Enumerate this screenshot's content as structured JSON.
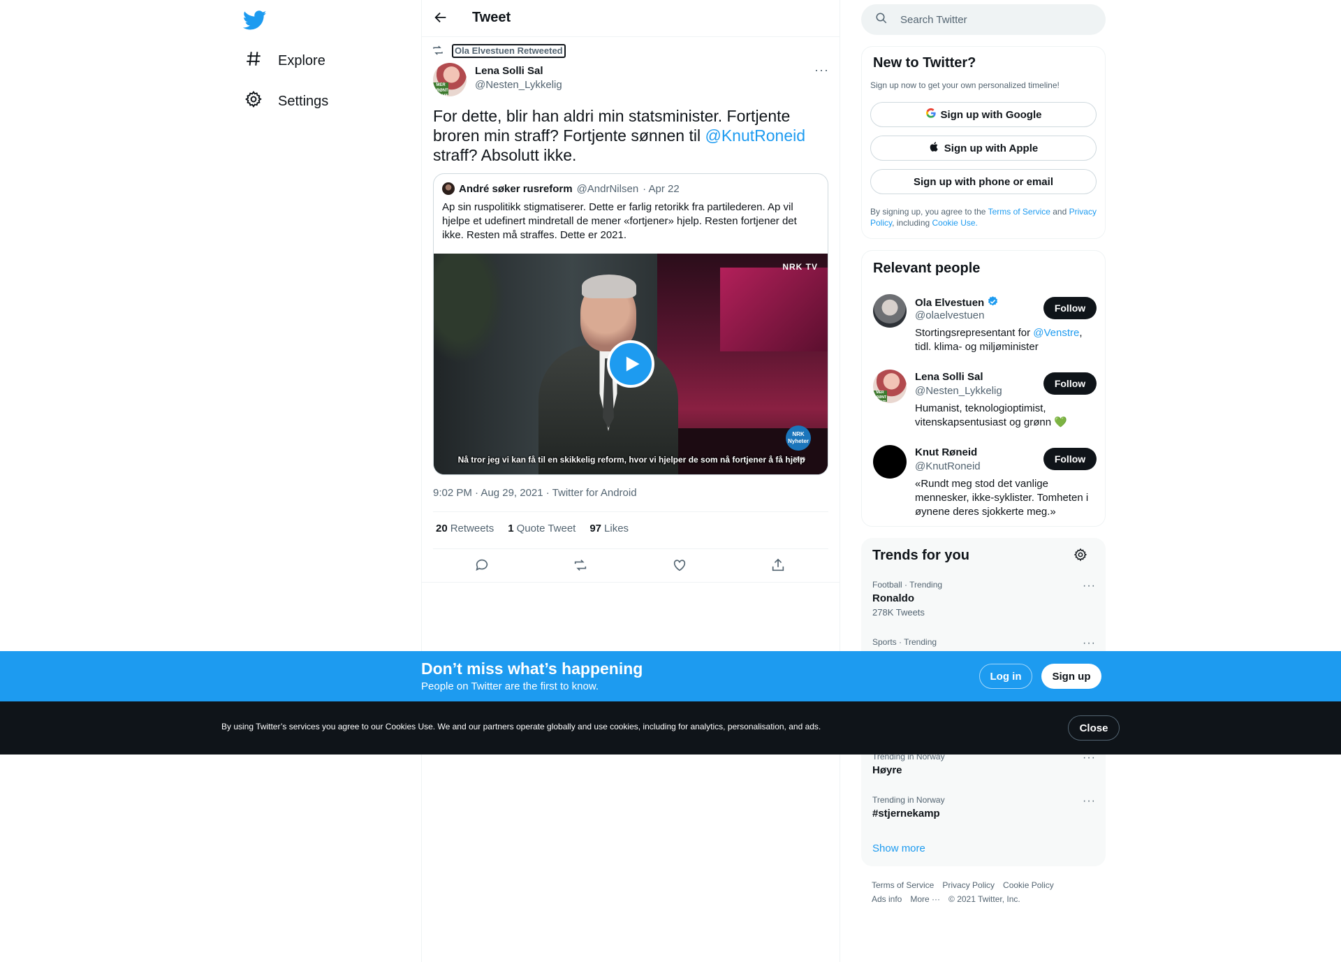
{
  "nav": {
    "items": [
      {
        "label": "Explore",
        "icon": "hashtag-icon"
      },
      {
        "label": "Settings",
        "icon": "gear-icon"
      }
    ]
  },
  "header": {
    "title": "Tweet"
  },
  "tweet": {
    "retweeted_by": "Ola Elvestuen Retweeted",
    "author_name": "Lena Solli Sal",
    "author_handle": "@Nesten_Lykkelig",
    "avatar_badge": "MER GRØNT STEMT",
    "text_part1": "For dette, blir han aldri min statsminister. Fortjente broren min straff? Fortjente sønnen til ",
    "text_mention": "@KnutRoneid",
    "text_part2": " straff? Absolutt ikke.",
    "timestamp": "9:02 PM · Aug 29, 2021 · Twitter for Android",
    "stats": {
      "retweets_count": "20",
      "retweets_label": "Retweets",
      "quotes_count": "1",
      "quotes_label": "Quote Tweet",
      "likes_count": "97",
      "likes_label": "Likes"
    }
  },
  "quote": {
    "author_name": "André søker rusreform",
    "author_handle": "@AndrNilsen",
    "date": "· Apr 22",
    "text": "Ap sin ruspolitikk stigmatiserer. Dette er farlig retorikk fra partilederen. Ap vil hjelpe et udefinert mindretall de mener «fortjener» hjelp. Resten fortjener det ikke. Resten må straffes. Dette er 2021.",
    "video": {
      "channel_logo": "NRK TV",
      "badge": "NRK Nyheter",
      "subtitle": "Nå tror jeg vi kan få til en skikkelig reform, hvor vi hjelper de som nå fortjener å få hjelp",
      "time": "23:05"
    }
  },
  "search": {
    "placeholder": "Search Twitter"
  },
  "signup_panel": {
    "title": "New to Twitter?",
    "subtitle": "Sign up now to get your own personalized timeline!",
    "google": "Sign up with Google",
    "apple": "Sign up with Apple",
    "phone": "Sign up with phone or email",
    "legal_1": "By signing up, you agree to the ",
    "tos": "Terms of Service",
    "legal_2": " and ",
    "privacy": "Privacy Policy",
    "legal_3": ", including ",
    "cookie": "Cookie Use."
  },
  "people": {
    "title": "Relevant people",
    "follow_label": "Follow",
    "list": [
      {
        "name": "Ola Elvestuen",
        "handle": "@olaelvestuen",
        "bio_a": "Stortingsrepresentant for ",
        "bio_link": "@Venstre",
        "bio_b": ", tidl. klima- og miljøminister",
        "verified": true
      },
      {
        "name": "Lena Solli Sal",
        "handle": "@Nesten_Lykkelig",
        "bio_a": "Humanist, teknologioptimist, vitenskapsentusiast og grønn 💚",
        "bio_link": "",
        "bio_b": "",
        "verified": false
      },
      {
        "name": "Knut Røneid",
        "handle": "@KnutRoneid",
        "bio_a": "«Rundt meg stod det vanlige mennesker, ikke-syklister. Tomheten i øynene deres sjokkerte meg.»",
        "bio_link": "",
        "bio_b": "",
        "verified": false
      }
    ]
  },
  "trends": {
    "title": "Trends for you",
    "items": [
      {
        "category": "Football · Trending",
        "name": "Ronaldo",
        "count": "278K Tweets"
      },
      {
        "category": "Sports · Trending",
        "name": "",
        "count": ""
      },
      {
        "category": "Trending in Norway",
        "name": "Høyre",
        "count": ""
      },
      {
        "category": "Trending in Norway",
        "name": "#stjernekamp",
        "count": ""
      }
    ],
    "show_more": "Show more"
  },
  "footer": {
    "links_row1": [
      "Terms of Service",
      "Privacy Policy",
      "Cookie Policy"
    ],
    "ads_info": "Ads info",
    "more": "More ···",
    "copyright": "© 2021 Twitter, Inc."
  },
  "banner": {
    "title": "Don’t miss what’s happening",
    "subtitle": "People on Twitter are the first to know.",
    "login": "Log in",
    "signup": "Sign up"
  },
  "cookie_bar": {
    "text": "By using Twitter’s services you agree to our Cookies Use. We and our partners operate globally and use cookies, including for analytics, personalisation, and ads.",
    "close": "Close"
  },
  "colors": {
    "accent": "#1d9bf0",
    "text": "#0f1419",
    "muted": "#536471",
    "cookie_bg": "#0f1419"
  }
}
